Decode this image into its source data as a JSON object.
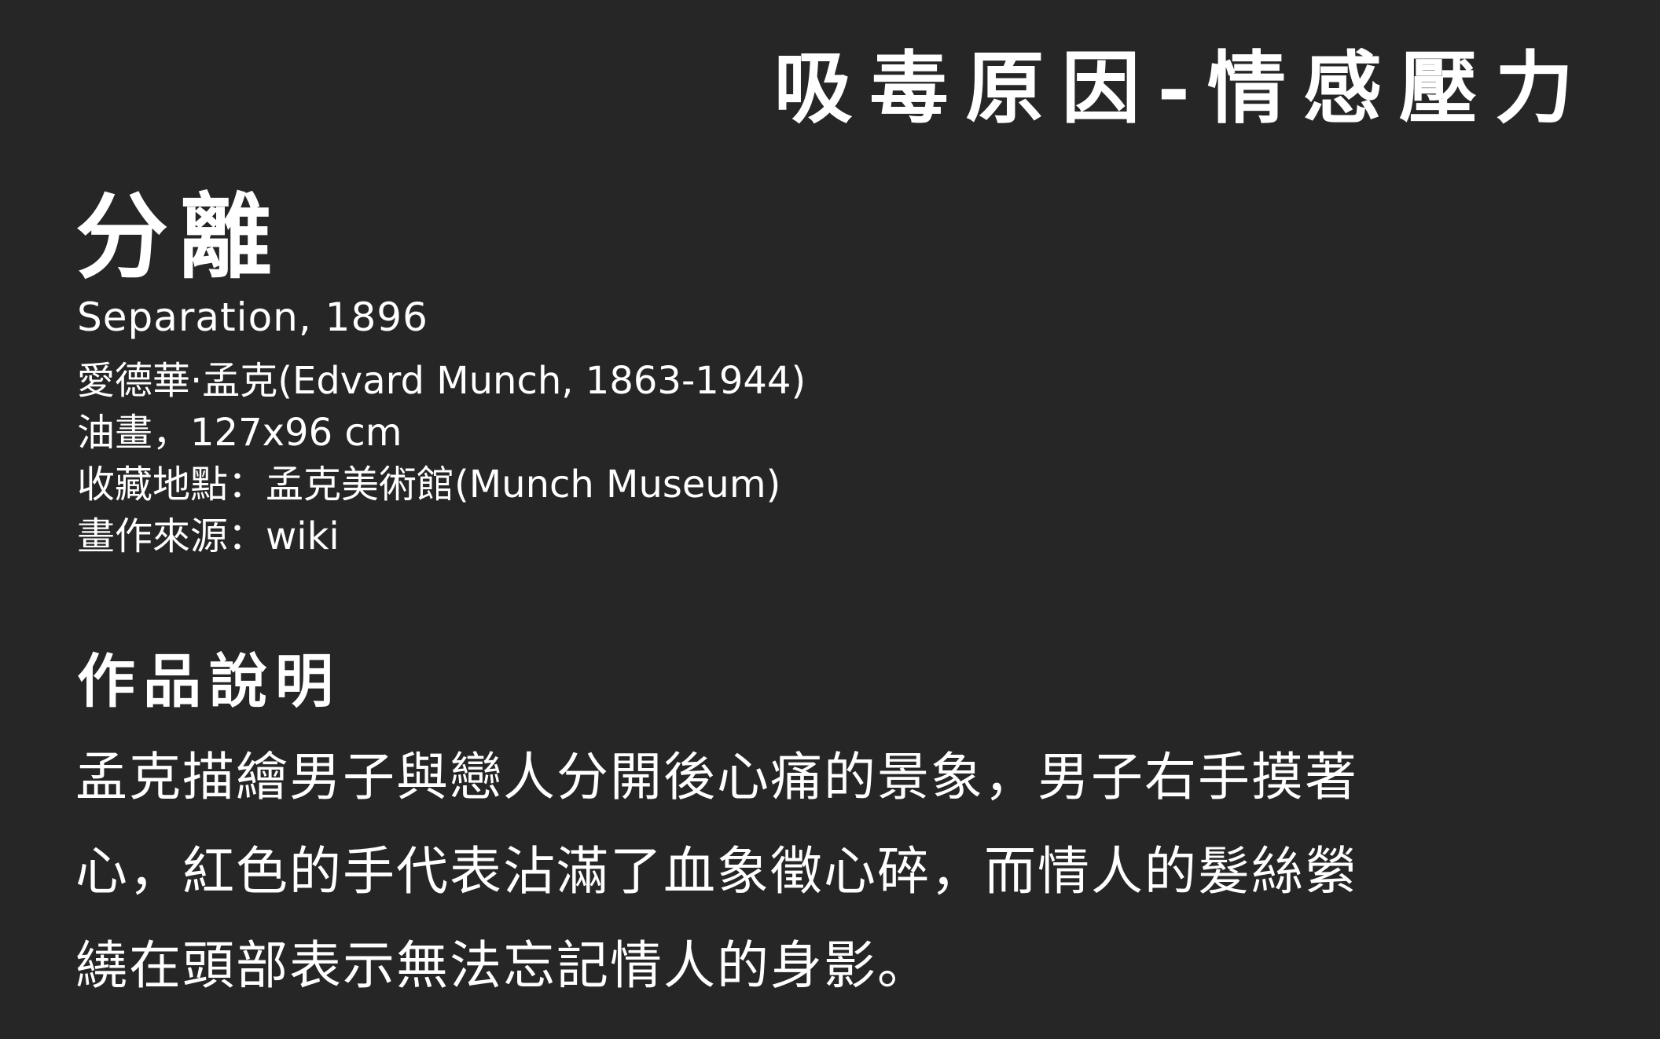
{
  "header": {
    "section_title": "吸毒原因-情感壓力"
  },
  "artwork": {
    "title": "分離",
    "english_title": "Separation, 1896",
    "artist": "愛德華·孟克(Edvard Munch, 1863-1944)",
    "medium_size": "油畫，127x96 cm",
    "collection": "收藏地點：孟克美術館(Munch Museum)",
    "source": "畫作來源：wiki"
  },
  "description": {
    "heading": "作品說明",
    "lines": [
      "孟克描繪男子與戀人分開後心痛的景象，男子右手摸著",
      "心，紅色的手代表沾滿了血象徵心碎，而情人的髮絲縈",
      "繞在頭部表示無法忘記情人的身影。"
    ]
  },
  "colors": {
    "background": "#262626",
    "text": "#ffffff"
  }
}
